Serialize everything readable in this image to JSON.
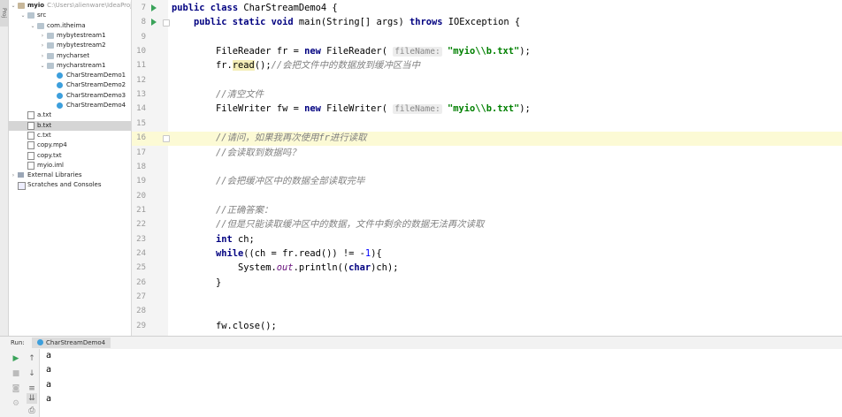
{
  "project": {
    "tree": [
      {
        "label": "myio",
        "path": "C:\\Users\\alienware\\IdeaProjec",
        "arrow": "⌄",
        "icon": "folderp",
        "bold": true
      },
      {
        "label": "src",
        "arrow": "⌄",
        "icon": "folder"
      },
      {
        "label": "com.itheima",
        "arrow": "⌄",
        "icon": "folder"
      },
      {
        "label": "mybytestream1",
        "arrow": "›",
        "icon": "folder"
      },
      {
        "label": "mybytestream2",
        "arrow": "›",
        "icon": "folder"
      },
      {
        "label": "mycharset",
        "arrow": "›",
        "icon": "folder"
      },
      {
        "label": "mycharstream1",
        "arrow": "⌄",
        "icon": "folder"
      },
      {
        "label": "CharStreamDemo1",
        "arrow": "",
        "icon": "cls"
      },
      {
        "label": "CharStreamDemo2",
        "arrow": "",
        "icon": "cls"
      },
      {
        "label": "CharStreamDemo3",
        "arrow": "",
        "icon": "cls"
      },
      {
        "label": "CharStreamDemo4",
        "arrow": "",
        "icon": "cls"
      },
      {
        "label": "a.txt",
        "arrow": "",
        "icon": "file"
      },
      {
        "label": "b.txt",
        "arrow": "",
        "icon": "file",
        "selected": true
      },
      {
        "label": "c.txt",
        "arrow": "",
        "icon": "file"
      },
      {
        "label": "copy.mp4",
        "arrow": "",
        "icon": "file"
      },
      {
        "label": "copy.txt",
        "arrow": "",
        "icon": "file"
      },
      {
        "label": "myio.iml",
        "arrow": "",
        "icon": "file"
      },
      {
        "label": "External Libraries",
        "arrow": "›",
        "icon": "ext"
      },
      {
        "label": "Scratches and Consoles",
        "arrow": "",
        "icon": "scratch"
      }
    ]
  },
  "side_tab": "Proj",
  "editor": {
    "highlight_line": 16,
    "lines": [
      {
        "n": "7",
        "run": true,
        "fold": false,
        "html": "<span class=\"kw\">public class</span> CharStreamDemo4 {",
        "indent": 0
      },
      {
        "n": "8",
        "run": true,
        "fold": true,
        "html": "<span class=\"kw\">public static void</span> main(String[] args) <span class=\"kw\">throws</span> IOException {",
        "indent": 1
      },
      {
        "n": "9",
        "html": "",
        "indent": 2
      },
      {
        "n": "10",
        "html": "FileReader fr = <span class=\"kw\">new</span> FileReader( <span class=\"hint\">fileName:</span> <span class=\"st\">\"myio\\\\b.txt\"</span>);",
        "indent": 2
      },
      {
        "n": "11",
        "html": "fr.<span class=\"mhl\">read</span>();<span class=\"cm\">//会把文件中的数据放到缓冲区当中</span>",
        "indent": 2
      },
      {
        "n": "12",
        "html": "",
        "indent": 2
      },
      {
        "n": "13",
        "html": "<span class=\"cm\">//清空文件</span>",
        "indent": 2
      },
      {
        "n": "14",
        "html": "FileWriter fw = <span class=\"kw\">new</span> FileWriter( <span class=\"hint\">fileName:</span> <span class=\"st\">\"myio\\\\b.txt\"</span>);",
        "indent": 2
      },
      {
        "n": "15",
        "html": "",
        "indent": 2
      },
      {
        "n": "16",
        "fold": true,
        "html": "<span class=\"cm\">//请问，如果我再次使用fr进行读取</span>",
        "indent": 2
      },
      {
        "n": "17",
        "html": "<span class=\"cm\">//会读取到数据吗？</span>",
        "indent": 2
      },
      {
        "n": "18",
        "html": "",
        "indent": 2
      },
      {
        "n": "19",
        "html": "<span class=\"cm\">//会把缓冲区中的数据全部读取完毕</span>",
        "indent": 2
      },
      {
        "n": "20",
        "html": "",
        "indent": 2
      },
      {
        "n": "21",
        "html": "<span class=\"cm\">//正确答案：</span>",
        "indent": 2
      },
      {
        "n": "22",
        "html": "<span class=\"cm\">//但是只能读取缓冲区中的数据，文件中剩余的数据无法再次读取</span>",
        "indent": 2
      },
      {
        "n": "23",
        "html": "<span class=\"kw\">int</span> ch;",
        "indent": 2
      },
      {
        "n": "24",
        "html": "<span class=\"kw\">while</span>((ch = fr.read()) != -<span class=\"num\">1</span>){",
        "indent": 2
      },
      {
        "n": "25",
        "html": "System.<span class=\"st2\">out</span>.println((<span class=\"kw\">char</span>)ch);",
        "indent": 3
      },
      {
        "n": "26",
        "html": "}",
        "indent": 2
      },
      {
        "n": "27",
        "html": "",
        "indent": 2
      },
      {
        "n": "28",
        "html": "",
        "indent": 2
      },
      {
        "n": "29",
        "html": "fw.close();",
        "indent": 2
      }
    ]
  },
  "run_panel": {
    "label": "Run:",
    "tab": "CharStreamDemo4",
    "output": [
      "a",
      "a",
      "a",
      "a"
    ]
  }
}
